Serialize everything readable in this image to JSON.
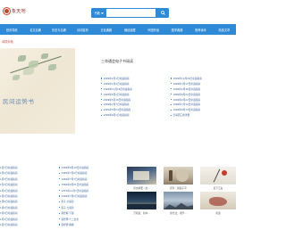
{
  "header": {
    "logo_text": "象天地",
    "search": {
      "select_label": "书籍",
      "placeholder": ""
    }
  },
  "nav": {
    "items": [
      "首页导航",
      "名文名著",
      "历史与名著",
      "诗词赏析",
      "文化典籍",
      "佛经道藏",
      "外国作品",
      "国学典籍",
      "推荐读本",
      "精选文章"
    ]
  },
  "breadcrumb": "诗词天地",
  "feature": {
    "image_text": "民间运势书",
    "title": "三命通会电子书阅读",
    "links": [
      "1999年2月1日命运指南",
      "1999年12月16日命运指南",
      "1999年1月2日命运指南",
      "1999年3月17日命运指南",
      "1999年11月16日命运指南",
      "1999年2月16日命运指南",
      "1999年6月1日命运指南",
      "1999年6月22日命运指南",
      "1999年5月19日命运指南",
      "1999年2月22日命运指南",
      "1999年2月7日命运指南",
      "1999年7月19日命运指南",
      "1999年5月24日命运指南",
      "1999年6月13日命运指南",
      "1999年6月1日命运指南",
      "滨海因三角津要"
    ]
  },
  "lower": {
    "col1": [
      "1月7日命运指南",
      "1月2日命运指南",
      "1月3日命运指南",
      "1月3日命运指南",
      "1月1日命运指南",
      "1月1日命运指南",
      "1月6日命运指南",
      "1月0日命运指南",
      "1月3日命运指南",
      "1月1日命运指南",
      "1月7日命运指南"
    ],
    "col2": [
      "1999年8月19日命运指南",
      "1999年7月2日命运指南",
      "1999年7月7日命运指南",
      "1999年8月21日命运指南",
      "1975年11月7日命运指南",
      "1999年7月5日命运指南",
      "墨子·六韬论",
      "墨子·七韬论",
      "墨经解·下篇",
      "墨经释·十二论文",
      "墨经释·典籍"
    ],
    "books": [
      {
        "caption": "诗文摘要（文..."
      },
      {
        "caption": "招手：诸葛子平"
      },
      {
        "caption": "蓝下江右"
      },
      {
        "caption": "万机运：新中..."
      },
      {
        "caption": "综合法：诸学..."
      },
      {
        "caption": "星运"
      }
    ]
  },
  "colors": {
    "accent": "#2e8ad6",
    "link": "#3a5f99",
    "breadcrumb": "#cc3333"
  },
  "icons": {
    "search": "search-icon",
    "dropdown": "chevron-down-icon"
  }
}
